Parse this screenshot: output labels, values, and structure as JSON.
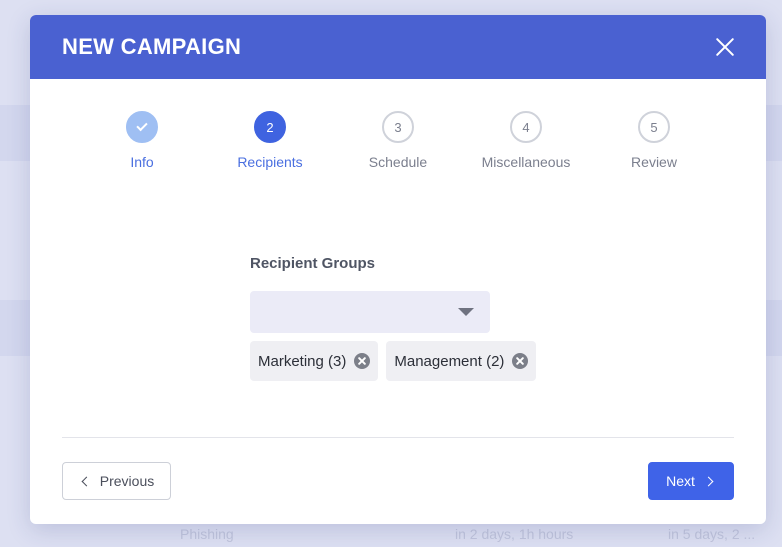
{
  "modal": {
    "title": "NEW CAMPAIGN"
  },
  "stepper": {
    "steps": [
      {
        "number": "",
        "label": "Info",
        "state": "done"
      },
      {
        "number": "2",
        "label": "Recipients",
        "state": "active"
      },
      {
        "number": "3",
        "label": "Schedule",
        "state": "pending"
      },
      {
        "number": "4",
        "label": "Miscellaneous",
        "state": "pending"
      },
      {
        "number": "5",
        "label": "Review",
        "state": "pending"
      }
    ]
  },
  "form": {
    "recipient_groups_label": "Recipient Groups",
    "selected_groups": [
      {
        "label": "Marketing (3)"
      },
      {
        "label": "Management (2)"
      }
    ]
  },
  "footer": {
    "previous_label": "Previous",
    "next_label": "Next"
  },
  "background": {
    "row_text_1": "Phishing",
    "row_text_2": "in 2 days, 1h hours",
    "row_text_3": "in 5 days, 2 ..."
  },
  "colors": {
    "header": "#4a61d1",
    "primary": "#3f63e8",
    "done_step": "#9fbff3"
  }
}
